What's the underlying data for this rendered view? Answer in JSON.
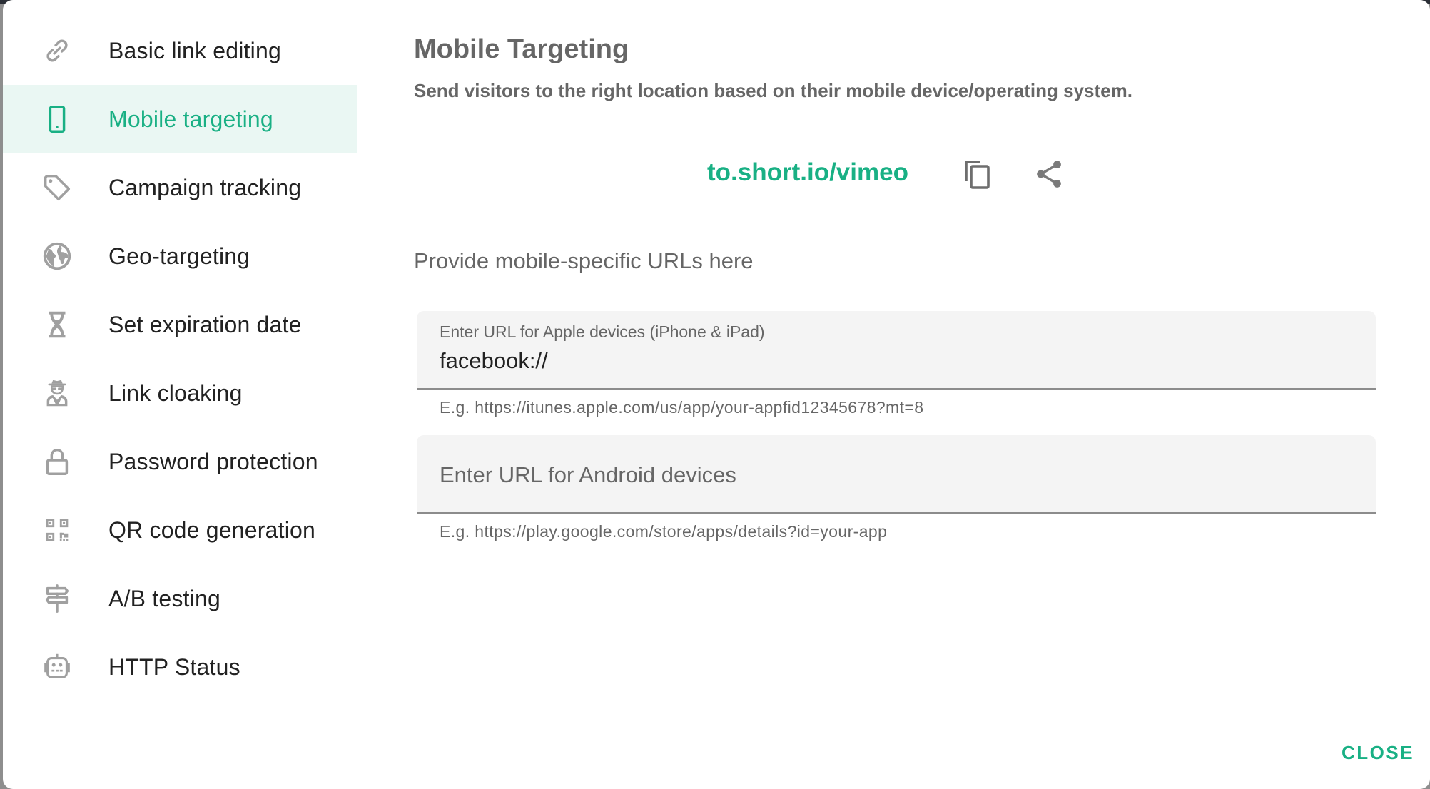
{
  "sidebar": {
    "items": [
      {
        "label": "Basic link editing",
        "icon": "link-icon",
        "active": false
      },
      {
        "label": "Mobile targeting",
        "icon": "smartphone-icon",
        "active": true
      },
      {
        "label": "Campaign tracking",
        "icon": "tag-icon",
        "active": false
      },
      {
        "label": "Geo-targeting",
        "icon": "globe-icon",
        "active": false
      },
      {
        "label": "Set expiration date",
        "icon": "hourglass-icon",
        "active": false
      },
      {
        "label": "Link cloaking",
        "icon": "incognito-icon",
        "active": false
      },
      {
        "label": "Password protection",
        "icon": "lock-icon",
        "active": false
      },
      {
        "label": "QR code generation",
        "icon": "qr-code-icon",
        "active": false
      },
      {
        "label": "A/B testing",
        "icon": "signpost-icon",
        "active": false
      },
      {
        "label": "HTTP Status",
        "icon": "robot-icon",
        "active": false
      }
    ]
  },
  "main": {
    "title": "Mobile Targeting",
    "subtitle": "Send visitors to the right location based on their mobile device/operating system.",
    "short_link": "to.short.io/vimeo",
    "copy_icon": "copy-icon",
    "share_icon": "share-icon",
    "section_label": "Provide mobile-specific URLs here",
    "apple_field": {
      "label": "Enter URL for Apple devices (iPhone & iPad)",
      "value": "facebook://",
      "hint": "E.g. https://itunes.apple.com/us/app/your-appfid12345678?mt=8"
    },
    "android_field": {
      "placeholder": "Enter URL for Android devices",
      "value": "",
      "hint": "E.g. https://play.google.com/store/apps/details?id=your-app"
    }
  },
  "footer": {
    "close_label": "CLOSE"
  },
  "colors": {
    "accent": "#19b084",
    "active_bg": "#eaf7f3",
    "icon_gray": "#a0a0a0",
    "text_dark": "#222222",
    "text_muted": "#666666",
    "field_bg": "#f4f4f4"
  }
}
